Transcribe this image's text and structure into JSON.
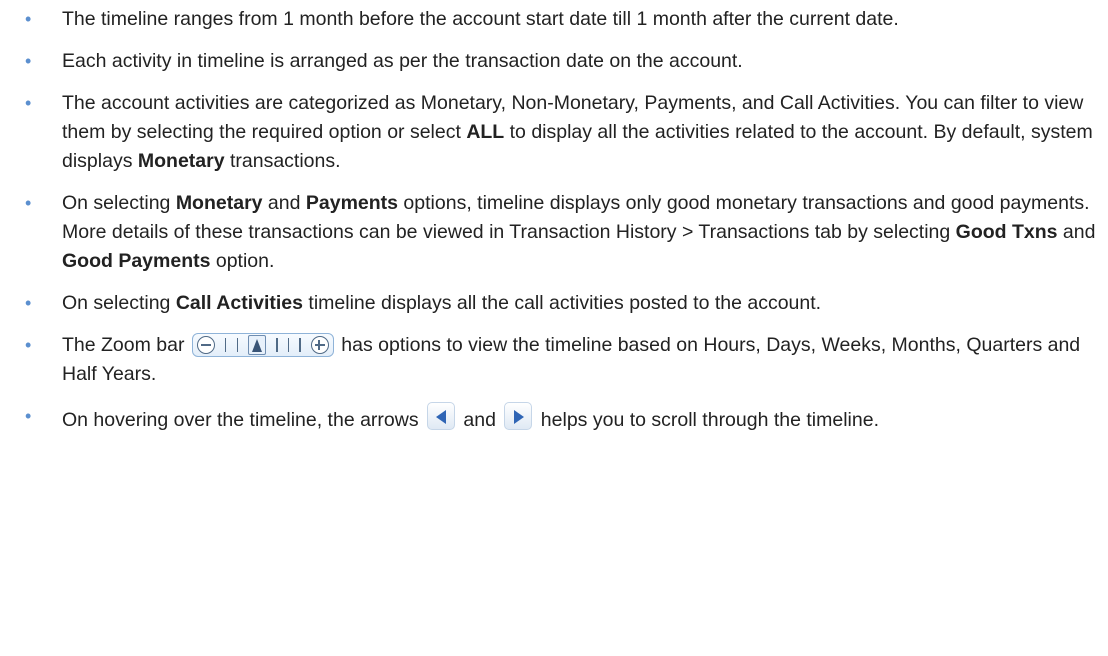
{
  "items": [
    {
      "text": "The timeline ranges from 1 month before the account start date till 1 month after the current date."
    },
    {
      "text": "Each activity in timeline is arranged as per the transaction date on the account."
    },
    {
      "t1": "The account activities are categorized as Monetary, Non-Monetary, Payments, and Call Activities. You can filter to view them by selecting the required option or select ",
      "b1": "ALL",
      "t2": " to display all the activities related to the account. By default, system displays ",
      "b2": "Monetary",
      "t3": " transactions."
    },
    {
      "t1": "On selecting ",
      "b1": "Monetary",
      "t2": " and ",
      "b2": "Payments",
      "t3": " options, timeline displays only good monetary transactions and good payments. More details of these transactions can be viewed in Transaction History > Transactions tab by selecting ",
      "b3": "Good Txns",
      "t4": " and ",
      "b4": "Good Payments",
      "t5": " option."
    },
    {
      "t1": "On selecting ",
      "b1": "Call Activities",
      "t2": " timeline displays all the call activities posted to the account."
    },
    {
      "t1": "The Zoom bar ",
      "t2": " has options to view the timeline based on Hours, Days, Weeks, Months, Quarters and Half Years."
    },
    {
      "t1": "On hovering over the timeline, the arrows ",
      "t2": " and ",
      "t3": " helps you to scroll through the timeline."
    }
  ],
  "bullet": "•",
  "icons": {
    "zoom_bar": "zoom-bar-icon",
    "scroll_left": "scroll-left-arrow-icon",
    "scroll_right": "scroll-right-arrow-icon"
  },
  "colors": {
    "bullet": "#5b8fcf",
    "arrow": "#2f65b5",
    "text": "#222222"
  }
}
